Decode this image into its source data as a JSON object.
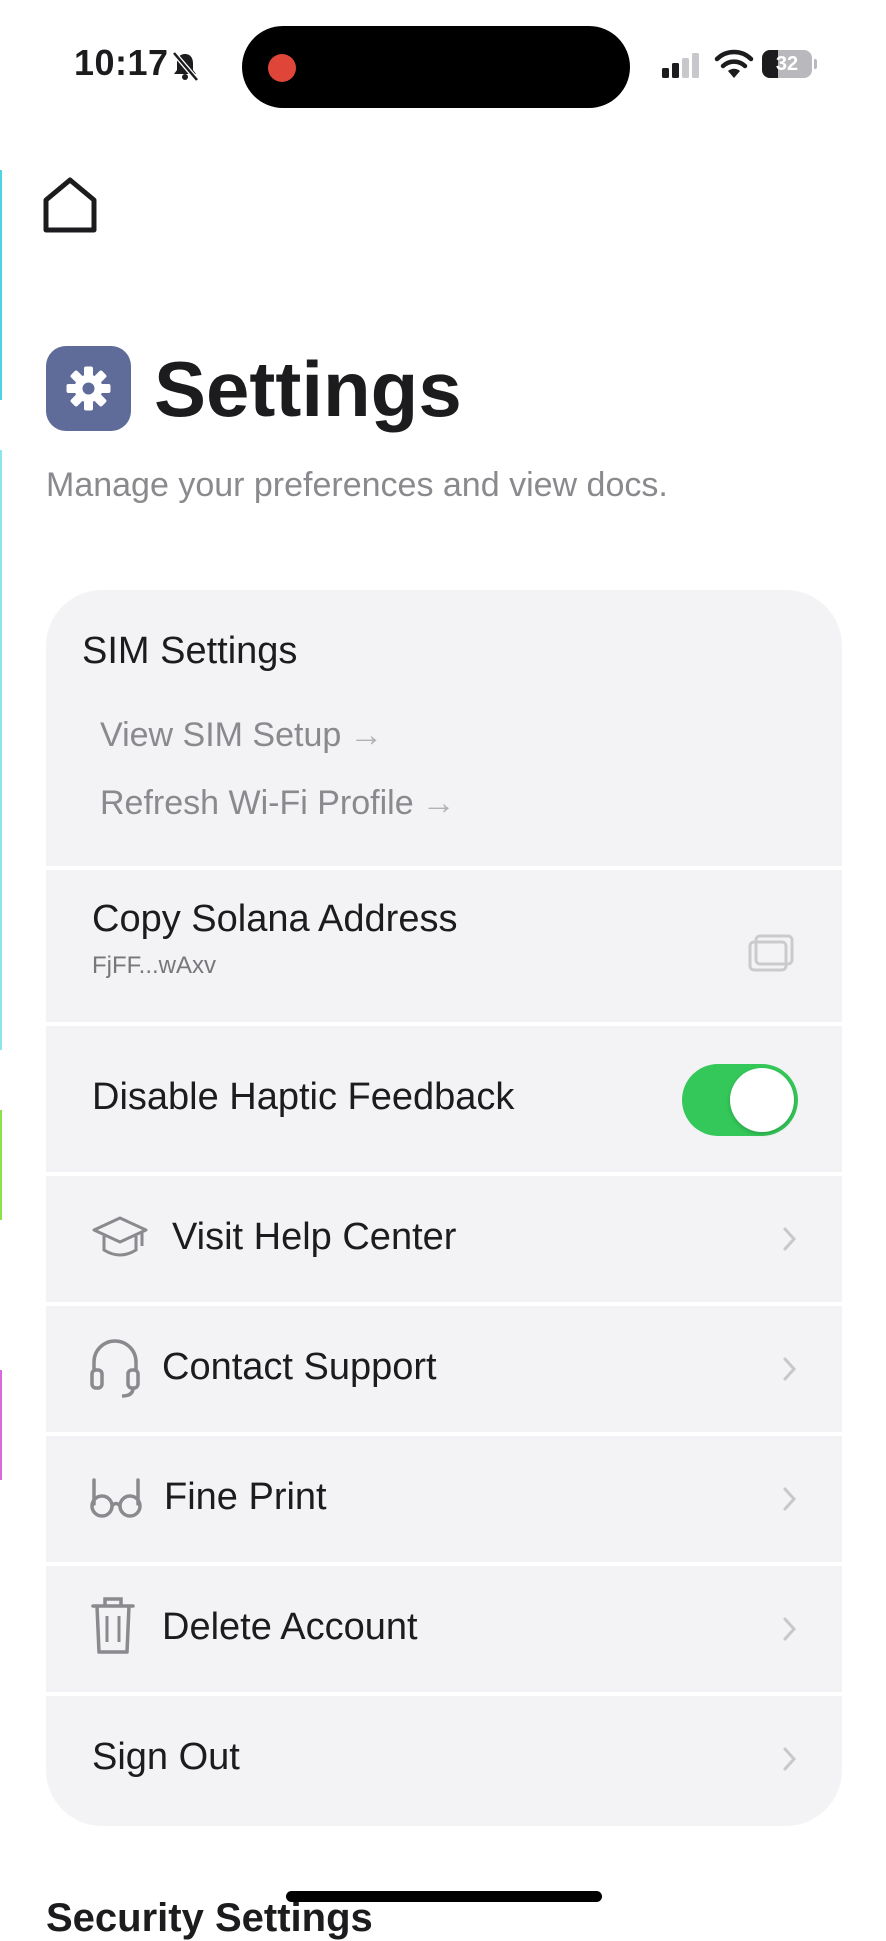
{
  "status_bar": {
    "time": "10:17",
    "battery_percent": "32",
    "battery_level": 0.32
  },
  "header": {
    "title": "Settings",
    "subtitle": "Manage your preferences and view docs."
  },
  "sim_settings": {
    "title": "SIM Settings",
    "links": [
      {
        "label": "View SIM Setup",
        "arrow": "→"
      },
      {
        "label": "Refresh Wi-Fi Profile",
        "arrow": "→"
      }
    ]
  },
  "solana": {
    "label": "Copy Solana Address",
    "address": "FjFF...wAxv"
  },
  "haptics": {
    "label": "Disable Haptic Feedback",
    "enabled": true
  },
  "menu": [
    {
      "label": "Visit Help Center",
      "icon": "graduation-cap-icon"
    },
    {
      "label": "Contact Support",
      "icon": "headset-icon"
    },
    {
      "label": "Fine Print",
      "icon": "glasses-icon"
    },
    {
      "label": "Delete Account",
      "icon": "trash-icon"
    },
    {
      "label": "Sign Out",
      "icon": ""
    }
  ],
  "next_section": {
    "title": "Security Settings"
  },
  "colors": {
    "accent_toggle": "#34c759",
    "app_icon_bg": "#5f6b98",
    "card_bg": "#f3f3f5",
    "recording_dot": "#e0453a"
  }
}
